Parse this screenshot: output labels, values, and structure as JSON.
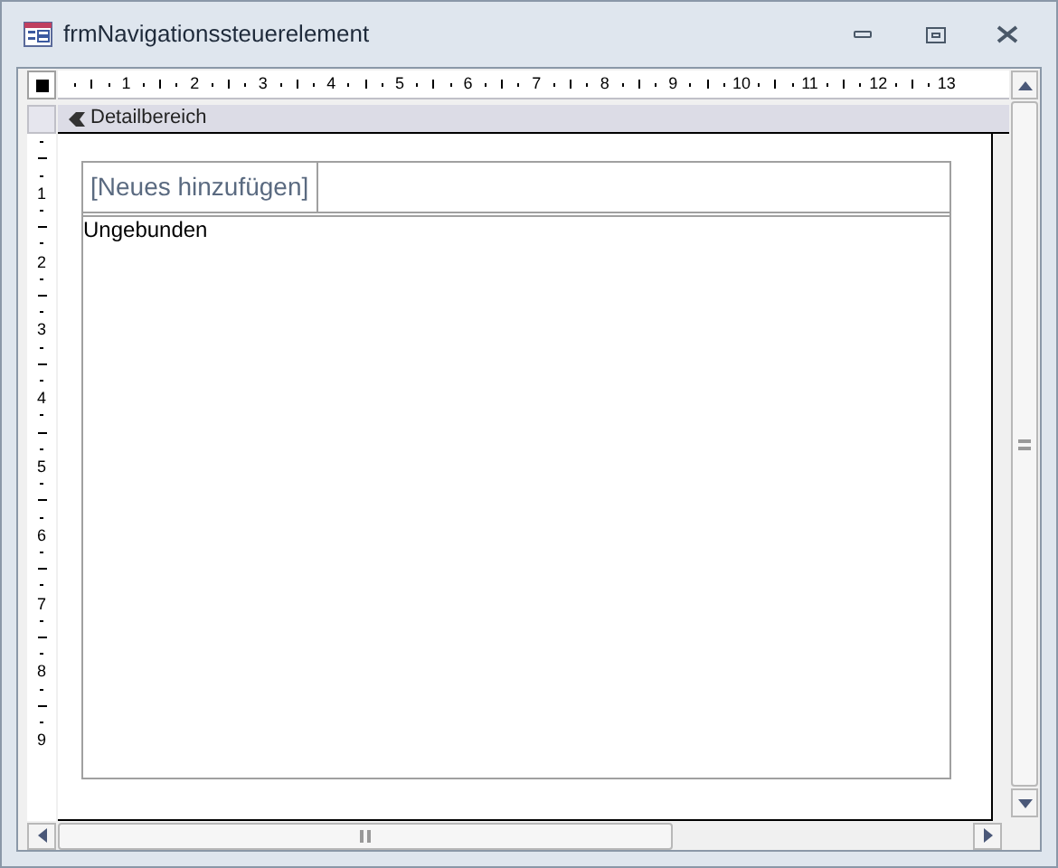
{
  "window": {
    "title": "frmNavigationssteuerelement"
  },
  "horizontal_ruler": {
    "labels": [
      "1",
      "2",
      "3",
      "4",
      "5",
      "6",
      "7",
      "8",
      "9",
      "10",
      "11",
      "12",
      "13"
    ]
  },
  "vertical_ruler": {
    "labels": [
      "1",
      "2",
      "3",
      "4",
      "5",
      "6",
      "7",
      "8",
      "9"
    ]
  },
  "section": {
    "title": "Detailbereich"
  },
  "navigation_control": {
    "tabs": [
      {
        "label": "[Neues hinzufügen]",
        "selected": false
      }
    ],
    "subform": {
      "label": "Ungebunden"
    }
  }
}
